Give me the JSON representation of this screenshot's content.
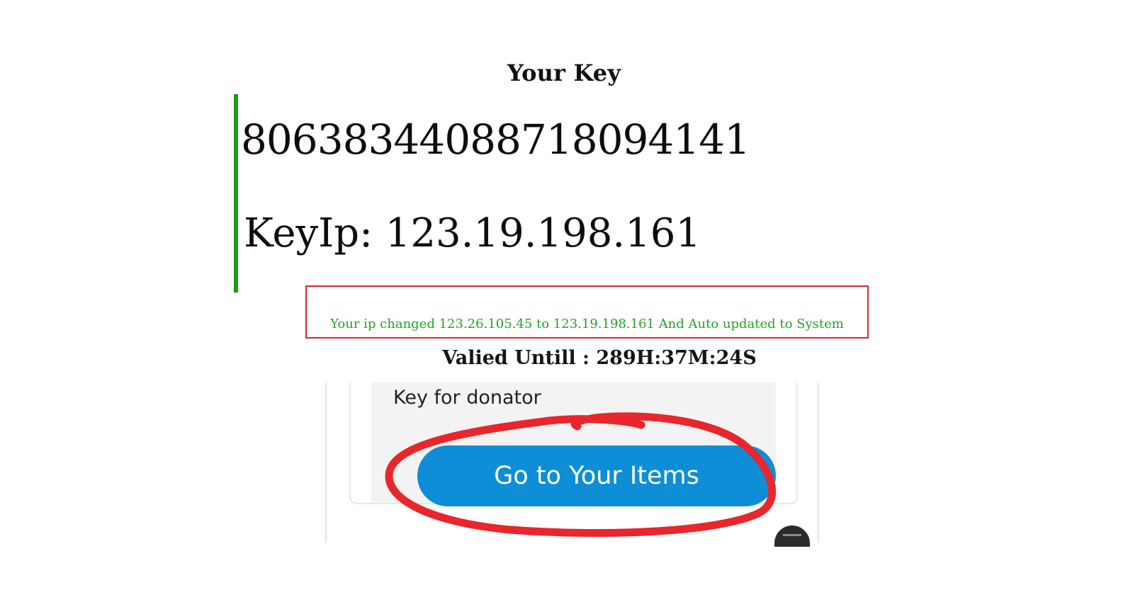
{
  "header": {
    "title": "Your Key"
  },
  "key": {
    "value": "80638344088718094141",
    "ip_line": "KeyIp: 123.19.198.161"
  },
  "notice": {
    "message": "Your ip changed 123.26.105.45 to 123.19.198.161 And Auto updated to System"
  },
  "validity": {
    "text": "Valied Untill : 289H:37M:24S"
  },
  "donator_card": {
    "label": "Key for donator",
    "button_label": "Go to Your Items"
  },
  "colors": {
    "accent_green": "#1a9a1a",
    "notice_border": "#d7262d",
    "notice_text": "#23a323",
    "button_blue": "#0d8ed6",
    "annotation_red": "#e8262c"
  },
  "icons": {
    "floating_button": "menu-icon"
  }
}
